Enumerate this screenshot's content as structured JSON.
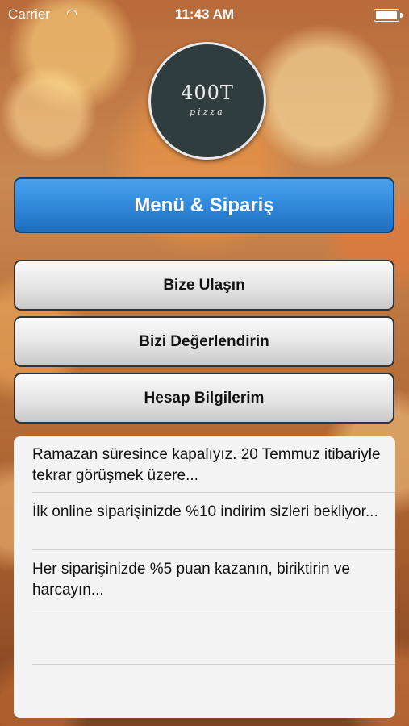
{
  "status_bar": {
    "carrier": "Carrier",
    "time": "11:43 AM",
    "wifi_icon": "wifi-icon",
    "battery_icon": "battery-icon"
  },
  "logo": {
    "brand": "400T",
    "subtitle": "pizza"
  },
  "buttons": {
    "menu_order": "Menü & Sipariş",
    "contact": "Bize Ulaşın",
    "rate": "Bizi Değerlendirin",
    "account": "Hesap Bilgilerim"
  },
  "colors": {
    "primary": "#2f86d9",
    "logo_bg": "#2f3d3f"
  },
  "news": [
    "Ramazan süresince kapalıyız. 20 Temmuz itibariyle tekrar görüşmek üzere...",
    "İlk online siparişinizde %10 indirim sizleri bekliyor...",
    "Her siparişinizde %5 puan kazanın, biriktirin ve harcayın...",
    ""
  ]
}
